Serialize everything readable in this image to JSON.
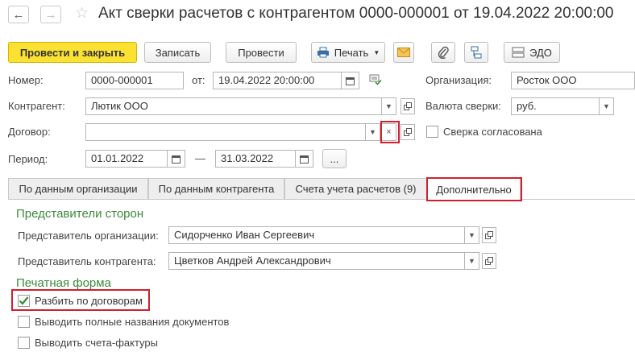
{
  "header": {
    "title": "Акт сверки расчетов с контрагентом 0000-000001 от 19.04.2022 20:00:00"
  },
  "toolbar": {
    "post_close": "Провести и закрыть",
    "save": "Записать",
    "post": "Провести",
    "print": "Печать",
    "edo": "ЭДО"
  },
  "form": {
    "number_label": "Номер:",
    "number_value": "0000-000001",
    "from_label": "от:",
    "date_value": "19.04.2022 20:00:00",
    "org_label": "Организация:",
    "org_value": "Росток ООО",
    "contractor_label": "Контрагент:",
    "contractor_value": "Лютик ООО",
    "currency_label": "Валюта сверки:",
    "currency_value": "руб.",
    "contract_label": "Договор:",
    "contract_value": "",
    "agreed_label": "Сверка согласована",
    "period_label": "Период:",
    "period_from": "01.01.2022",
    "period_dash": "—",
    "period_to": "31.03.2022",
    "period_more": "..."
  },
  "tabs": [
    {
      "label": "По данным организации"
    },
    {
      "label": "По данным контрагента"
    },
    {
      "label": "Счета учета расчетов (9)"
    },
    {
      "label": "Дополнительно"
    }
  ],
  "extra": {
    "reps_title": "Представители сторон",
    "org_rep_label": "Представитель организации:",
    "org_rep_value": "Сидорченко Иван Сергеевич",
    "contr_rep_label": "Представитель контрагента:",
    "contr_rep_value": "Цветков Андрей Александрович",
    "print_title": "Печатная форма",
    "split_label": "Разбить по договорам",
    "split_checked": true,
    "full_names_label": "Выводить полные названия документов",
    "full_names_checked": false,
    "invoices_label": "Выводить счета-фактуры",
    "invoices_checked": false
  },
  "colors": {
    "primary_button": "#fbe232",
    "section_title": "#3c8a3c",
    "highlight": "#d0202e",
    "check": "#2e8b2e"
  }
}
